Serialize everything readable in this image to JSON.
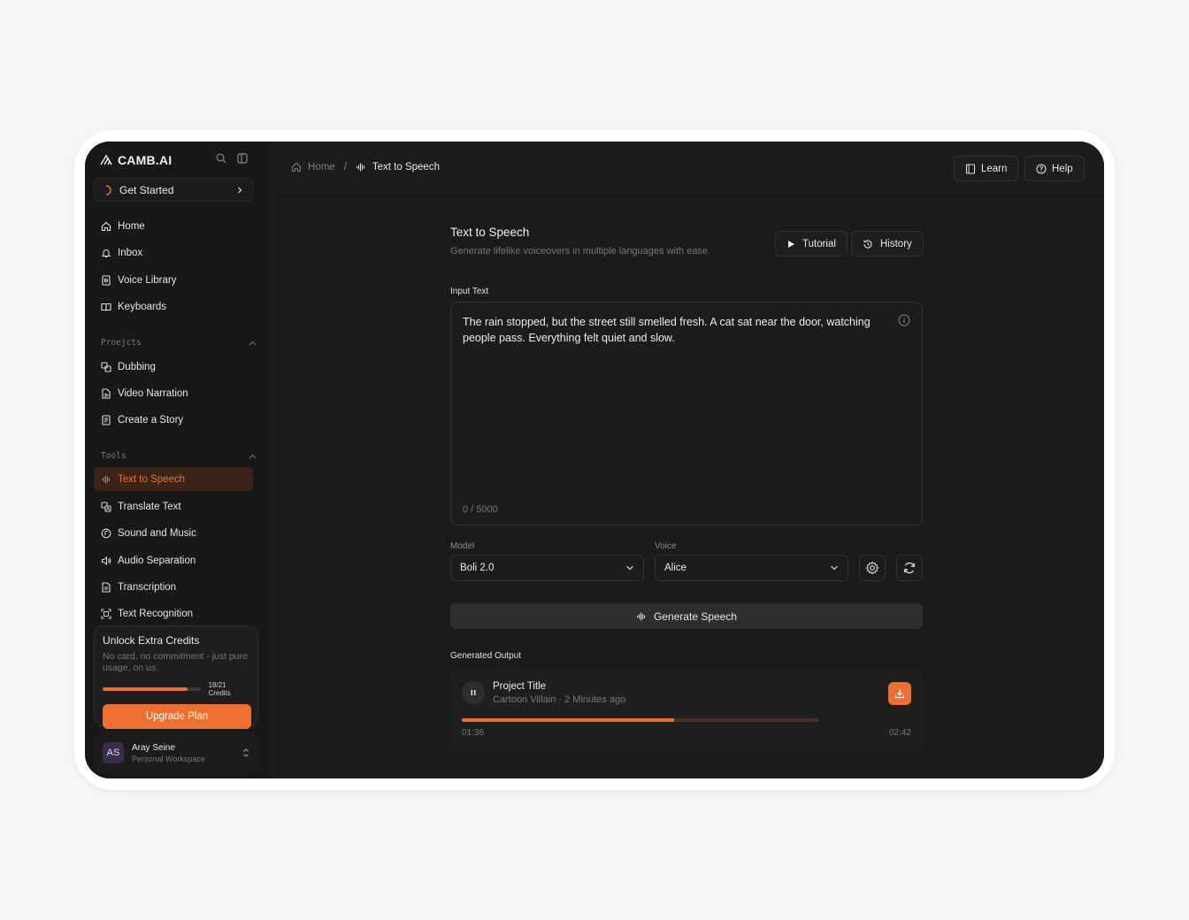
{
  "app": {
    "logo_text": "CAMB.AI"
  },
  "sidebar": {
    "get_started": "Get Started",
    "main_items": [
      {
        "label": "Home",
        "icon": "home-icon"
      },
      {
        "label": "Inbox",
        "icon": "bell-icon"
      },
      {
        "label": "Voice Library",
        "icon": "voice-library-icon"
      },
      {
        "label": "Keyboards",
        "icon": "book-icon"
      }
    ],
    "projects_label": "Proejcts",
    "project_items": [
      {
        "label": "Dubbing",
        "icon": "dubbing-icon"
      },
      {
        "label": "Video Narration",
        "icon": "video-file-icon"
      },
      {
        "label": "Create a Story",
        "icon": "story-icon"
      }
    ],
    "tools_label": "Tools",
    "tool_items": [
      {
        "label": "Text to Speech",
        "icon": "waveform-icon",
        "active": true
      },
      {
        "label": "Translate Text",
        "icon": "translate-icon"
      },
      {
        "label": "Sound and Music",
        "icon": "music-icon"
      },
      {
        "label": "Audio Separation",
        "icon": "speaker-icon"
      },
      {
        "label": "Transcription",
        "icon": "document-icon"
      },
      {
        "label": "Text Recognition",
        "icon": "scan-icon"
      }
    ],
    "credits": {
      "title": "Unlock Extra Credits",
      "subtitle": "No card, no commitment - just pure usage, on us.",
      "count": "18/21 Credits",
      "used": 18,
      "total": 21,
      "upgrade": "Upgrade Plan"
    },
    "user": {
      "initials": "AS",
      "name": "Aray Seine",
      "workspace": "Personal Workspace"
    }
  },
  "topbar": {
    "breadcrumb_home": "Home",
    "breadcrumb_sep": "/",
    "breadcrumb_current": "Text to Speech",
    "learn": "Learn",
    "help": "Help"
  },
  "page": {
    "title": "Text to Speech",
    "subtitle": "Generate lifelike voiceovers in multiple languages with ease.",
    "tutorial": "Tutorial",
    "history": "History",
    "input_label": "Input Text",
    "input_text": "The rain stopped, but the street still smelled fresh. A cat sat near the door, watching people pass. Everything felt quiet and slow.",
    "char_count": "0 / 5000",
    "model_label": "Model",
    "model_value": "Boli 2.0",
    "voice_label": "Voice",
    "voice_value": "Alice",
    "generate": "Generate Speech",
    "output_label": "Generated Output",
    "output": {
      "title": "Project Title",
      "meta": "Cartoon Villain · 2 Minutes ago",
      "current_time": "01:36",
      "duration": "02:42",
      "progress": 0.593
    }
  },
  "colors": {
    "accent": "#ee6f32",
    "background": "#1b1b1b",
    "sidebar": "#181818"
  }
}
